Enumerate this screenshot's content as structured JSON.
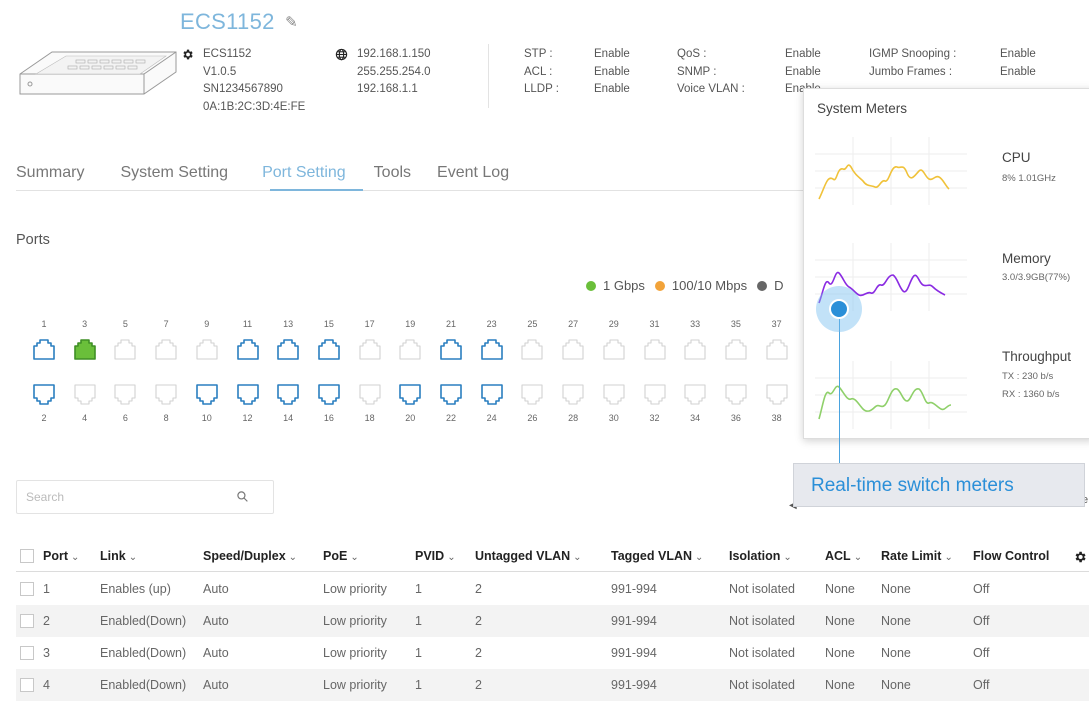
{
  "device": {
    "title": "ECS1152",
    "name": "ECS1152",
    "version": "V1.0.5",
    "serial": "SN1234567890",
    "mac": "0A:1B:2C:3D:4E:FE",
    "ip": "192.168.1.150",
    "mask": "255.255.254.0",
    "gateway": "192.168.1.1"
  },
  "features": {
    "stp_label": "STP :",
    "stp_value": "Enable",
    "acl_label": "ACL :",
    "acl_value": "Enable",
    "lldp_label": "LLDP :",
    "lldp_value": "Enable",
    "qos_label": "QoS :",
    "qos_value": "Enable",
    "snmp_label": "SNMP :",
    "snmp_value": "Enable",
    "voice_label": "Voice VLAN :",
    "voice_value": "Enable",
    "igmp_label": "IGMP Snooping :",
    "igmp_value": "Enable",
    "jumbo_label": "Jumbo Frames :",
    "jumbo_value": "Enable"
  },
  "tabs": [
    "Summary",
    "System Setting",
    "Port Setting",
    "Tools",
    "Event Log"
  ],
  "active_tab": "Port Setting",
  "ports": {
    "title": "Ports",
    "legend": [
      {
        "label": "1 Gbps",
        "color": "#6abf3a"
      },
      {
        "label": "100/10 Mbps",
        "color": "#f2a33a"
      },
      {
        "label": "D",
        "color": "#666666"
      }
    ],
    "top_numbers": [
      "1",
      "3",
      "5",
      "7",
      "9",
      "11",
      "13",
      "15",
      "17",
      "19",
      "21",
      "23",
      "25",
      "27",
      "29",
      "31",
      "33",
      "35",
      "37"
    ],
    "bottom_numbers": [
      "2",
      "4",
      "6",
      "8",
      "10",
      "12",
      "14",
      "16",
      "18",
      "20",
      "22",
      "24",
      "26",
      "28",
      "30",
      "32",
      "34",
      "36",
      "38"
    ],
    "top_states": [
      "blue",
      "green",
      "gray",
      "gray",
      "gray",
      "blue",
      "blue",
      "blue",
      "gray",
      "gray",
      "blue",
      "blue",
      "gray",
      "gray",
      "gray",
      "gray",
      "gray",
      "gray",
      "gray"
    ],
    "bottom_states": [
      "blue",
      "gray",
      "gray",
      "gray",
      "blue",
      "blue",
      "blue",
      "blue",
      "gray",
      "blue",
      "blue",
      "blue",
      "gray",
      "gray",
      "gray",
      "gray",
      "gray",
      "gray",
      "gray"
    ],
    "colors": {
      "blue": "#2a7fc0",
      "green": "#6abf3a",
      "gray": "#cfcfcf"
    }
  },
  "search": {
    "placeholder": "Search"
  },
  "table": {
    "headers": [
      "Port",
      "Link",
      "Speed/Duplex",
      "PoE",
      "PVID",
      "Untagged VLAN",
      "Tagged VLAN",
      "Isolation",
      "ACL",
      "Rate Limit",
      "Flow Control"
    ],
    "rows": [
      [
        "1",
        "Enables (up)",
        "Auto",
        "Low priority",
        "1",
        "2",
        "991-994",
        "Not isolated",
        "None",
        "None",
        "Off"
      ],
      [
        "2",
        "Enabled(Down)",
        "Auto",
        "Low priority",
        "1",
        "2",
        "991-994",
        "Not isolated",
        "None",
        "None",
        "Off"
      ],
      [
        "3",
        "Enabled(Down)",
        "Auto",
        "Low priority",
        "1",
        "2",
        "991-994",
        "Not isolated",
        "None",
        "None",
        "Off"
      ],
      [
        "4",
        "Enabled(Down)",
        "Auto",
        "Low priority",
        "1",
        "2",
        "991-994",
        "Not isolated",
        "None",
        "None",
        "Off"
      ]
    ]
  },
  "meters": {
    "title": "System Meters",
    "cpu": {
      "label": "CPU",
      "detail": "8%   1.01GHz",
      "color": "#f0c23a"
    },
    "memory": {
      "label": "Memory",
      "detail": "3.0/3.9GB(77%)",
      "color": "#8a2be2"
    },
    "throughput": {
      "label": "Throughput",
      "tx": "TX : 230 b/s",
      "rx": "RX : 1360 b/s",
      "color": "#8fd06a"
    }
  },
  "callout": {
    "label": "Real-time switch meters",
    "color": "#2a8fd8"
  }
}
